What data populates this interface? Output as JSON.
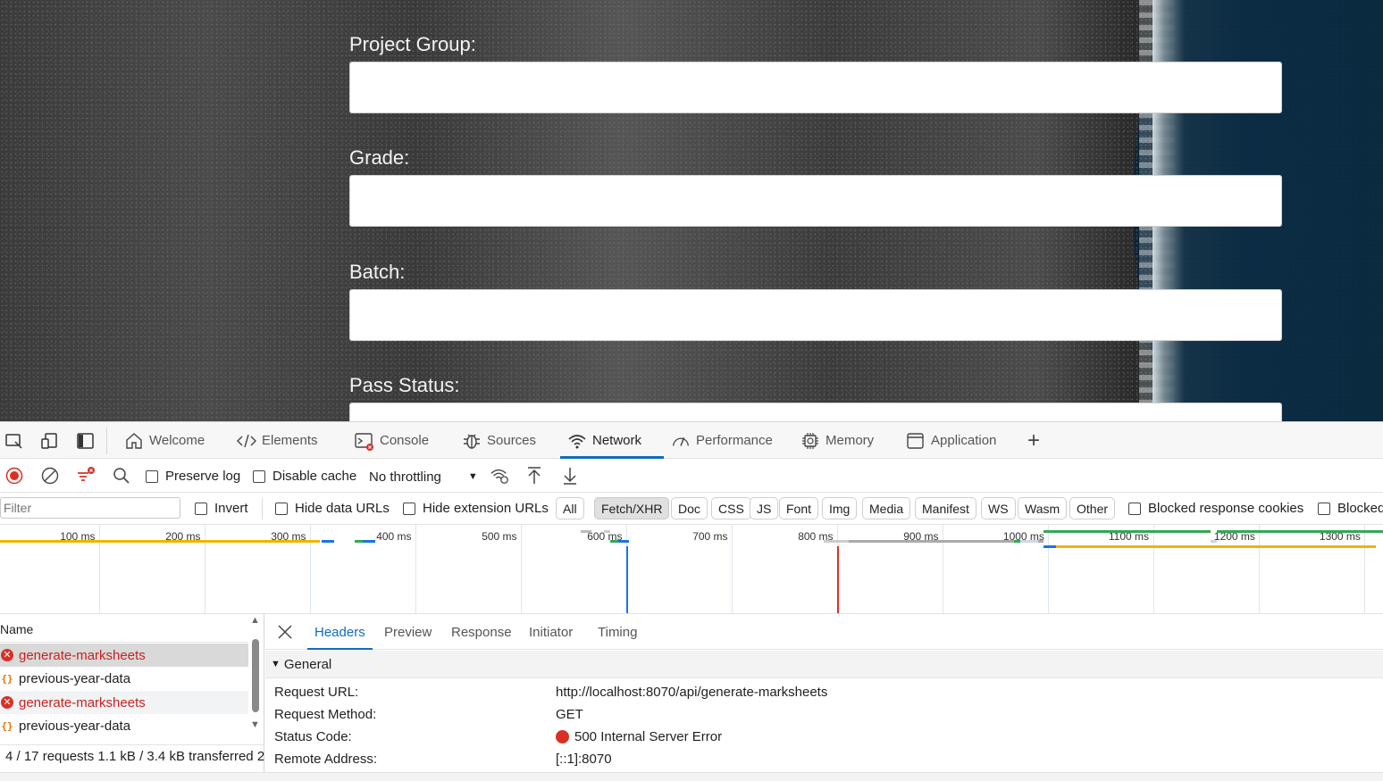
{
  "page": {
    "fields": [
      {
        "label": "Project Group:",
        "value": ""
      },
      {
        "label": "Grade:",
        "value": ""
      },
      {
        "label": "Batch:",
        "value": ""
      },
      {
        "label": "Pass Status:",
        "value": ""
      }
    ]
  },
  "devtools": {
    "tabs": [
      {
        "label": "Welcome",
        "icon": "home-icon"
      },
      {
        "label": "Elements",
        "icon": "code-icon"
      },
      {
        "label": "Console",
        "icon": "console-icon"
      },
      {
        "label": "Sources",
        "icon": "bug-icon"
      },
      {
        "label": "Network",
        "icon": "wifi-icon",
        "active": true
      },
      {
        "label": "Performance",
        "icon": "gauge-icon"
      },
      {
        "label": "Memory",
        "icon": "chip-icon"
      },
      {
        "label": "Application",
        "icon": "window-icon"
      }
    ],
    "add_tab_label": "+",
    "toolbar": {
      "preserve_log": "Preserve log",
      "disable_cache": "Disable cache",
      "throttling": "No throttling"
    },
    "filter": {
      "placeholder": "Filter",
      "invert": "Invert",
      "hide_data_urls": "Hide data URLs",
      "hide_extension_urls": "Hide extension URLs",
      "types": [
        "All",
        "Fetch/XHR",
        "Doc",
        "CSS",
        "JS",
        "Font",
        "Img",
        "Media",
        "Manifest",
        "WS",
        "Wasm",
        "Other"
      ],
      "selected_type": "Fetch/XHR",
      "blocked_response_cookies": "Blocked response cookies",
      "blocked_requests": "Blocked"
    },
    "overview": {
      "ticks": [
        "100 ms",
        "200 ms",
        "300 ms",
        "400 ms",
        "500 ms",
        "600 ms",
        "700 ms",
        "800 ms",
        "900 ms",
        "1000 ms",
        "1100 ms",
        "1200 ms",
        "1300 ms"
      ],
      "dom_content_loaded_ms": 600,
      "load_ms": 800,
      "colors": {
        "blue": "#1a73e8",
        "red": "#d93025",
        "orange": "#f0b400",
        "green": "#34a853"
      }
    },
    "requests": {
      "column_name": "Name",
      "rows": [
        {
          "name": "generate-marksheets",
          "status": "error"
        },
        {
          "name": "previous-year-data",
          "status": "ok"
        },
        {
          "name": "generate-marksheets",
          "status": "error"
        },
        {
          "name": "previous-year-data",
          "status": "ok"
        }
      ],
      "summary": "4 / 17 requests   1.1 kB / 3.4 kB transferred   2"
    },
    "detail": {
      "tabs": [
        "Headers",
        "Preview",
        "Response",
        "Initiator",
        "Timing"
      ],
      "active_tab": "Headers",
      "section_title": "General",
      "general": [
        {
          "key": "Request URL:",
          "value": "http://localhost:8070/api/generate-marksheets"
        },
        {
          "key": "Request Method:",
          "value": "GET"
        },
        {
          "key": "Status Code:",
          "value": "500 Internal Server Error"
        },
        {
          "key": "Remote Address:",
          "value": "[::1]:8070"
        }
      ]
    }
  }
}
